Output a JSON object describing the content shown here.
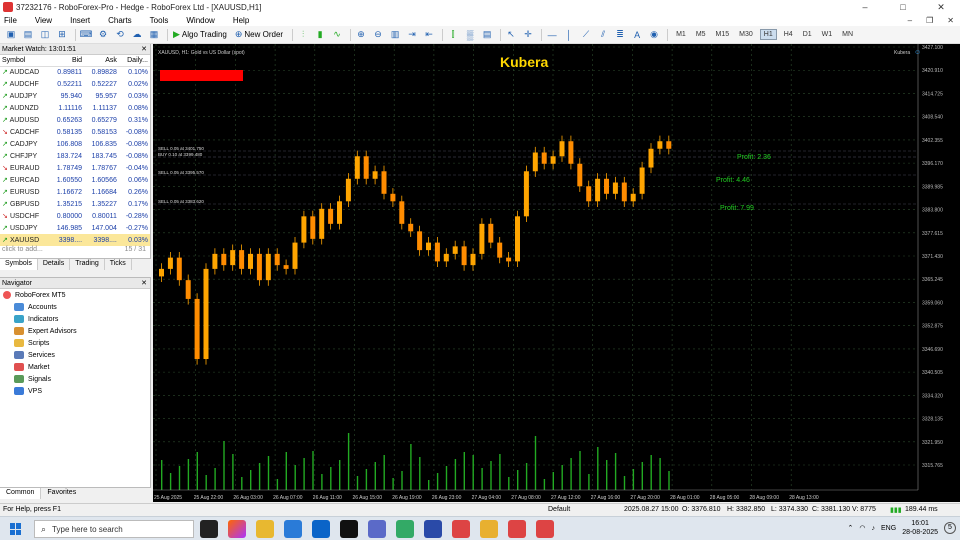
{
  "window": {
    "title": "37232176 - RoboForex-Pro - Hedge - RoboForex Ltd - [XAUUSD,H1]",
    "controls": [
      "–",
      "□",
      "✕"
    ]
  },
  "menu": [
    "File",
    "View",
    "Insert",
    "Charts",
    "Tools",
    "Window",
    "Help"
  ],
  "toolbar": {
    "algo_trading": "Algo Trading",
    "new_order": "New Order",
    "timeframes": [
      "M1",
      "M5",
      "M15",
      "M30",
      "H1",
      "H4",
      "D1",
      "W1",
      "MN"
    ],
    "active_timeframe": "H1"
  },
  "market_watch": {
    "title": "Market Watch: 13:01:51",
    "columns": [
      "Symbol",
      "Bid",
      "Ask",
      "Daily..."
    ],
    "rows": [
      {
        "symbol": "AUDCAD",
        "bid": "0.89811",
        "ask": "0.89828",
        "daily": "0.10%",
        "dir": "up"
      },
      {
        "symbol": "AUDCHF",
        "bid": "0.52211",
        "ask": "0.52227",
        "daily": "0.02%",
        "dir": "up"
      },
      {
        "symbol": "AUDJPY",
        "bid": "95.940",
        "ask": "95.957",
        "daily": "0.03%",
        "dir": "up"
      },
      {
        "symbol": "AUDNZD",
        "bid": "1.11116",
        "ask": "1.11137",
        "daily": "0.08%",
        "dir": "up"
      },
      {
        "symbol": "AUDUSD",
        "bid": "0.65263",
        "ask": "0.65279",
        "daily": "0.31%",
        "dir": "up"
      },
      {
        "symbol": "CADCHF",
        "bid": "0.58135",
        "ask": "0.58153",
        "daily": "-0.08%",
        "dir": "dn"
      },
      {
        "symbol": "CADJPY",
        "bid": "106.808",
        "ask": "106.835",
        "daily": "-0.08%",
        "dir": "up"
      },
      {
        "symbol": "CHFJPY",
        "bid": "183.724",
        "ask": "183.745",
        "daily": "-0.08%",
        "dir": "up"
      },
      {
        "symbol": "EURAUD",
        "bid": "1.78749",
        "ask": "1.78767",
        "daily": "-0.04%",
        "dir": "dn"
      },
      {
        "symbol": "EURCAD",
        "bid": "1.60550",
        "ask": "1.60566",
        "daily": "0.06%",
        "dir": "up"
      },
      {
        "symbol": "EURUSD",
        "bid": "1.16672",
        "ask": "1.16684",
        "daily": "0.26%",
        "dir": "up"
      },
      {
        "symbol": "GBPUSD",
        "bid": "1.35215",
        "ask": "1.35227",
        "daily": "0.17%",
        "dir": "up"
      },
      {
        "symbol": "USDCHF",
        "bid": "0.80000",
        "ask": "0.80011",
        "daily": "-0.28%",
        "dir": "dn"
      },
      {
        "symbol": "USDJPY",
        "bid": "146.985",
        "ask": "147.004",
        "daily": "-0.27%",
        "dir": "up"
      },
      {
        "symbol": "XAUUSD",
        "bid": "3398....",
        "ask": "3398....",
        "daily": "0.03%",
        "dir": "up"
      }
    ],
    "add_label": "click to add...",
    "count": "15 / 31",
    "tabs": [
      "Symbols",
      "Details",
      "Trading",
      "Ticks"
    ]
  },
  "navigator": {
    "title": "Navigator",
    "root": "RoboForex MT5",
    "items": [
      "Accounts",
      "Indicators",
      "Expert Advisors",
      "Scripts",
      "Services",
      "Market",
      "Signals",
      "VPS"
    ],
    "tabs": [
      "Common",
      "Favorites"
    ]
  },
  "chart": {
    "symbol_label": "XAUUSD, H1: Gold vs US Dollar (spot)",
    "ea_name": "Kubera",
    "ea_label": "Kubera",
    "order_lines": [
      "SELL 0.05 at 3401.750",
      "BUY 0.10 at 3399.480",
      "SELL 0.05 at 3395.570",
      "SELL 0.05 at 3383.620"
    ],
    "price_labels": [
      "3427.100",
      "3420.910",
      "3414.725",
      "3408.540",
      "3402.355",
      "3396.170",
      "3389.985",
      "3383.800",
      "3377.615",
      "3371.430",
      "3365.245",
      "3359.060",
      "3352.875",
      "3346.690",
      "3340.505",
      "3334.320",
      "3328.135",
      "3321.950",
      "3315.765"
    ],
    "time_labels": [
      "25 Aug 2025",
      "25 Aug 22:00",
      "26 Aug 03:00",
      "26 Aug 07:00",
      "26 Aug 11:00",
      "26 Aug 15:00",
      "26 Aug 19:00",
      "26 Aug 23:00",
      "27 Aug 04:00",
      "27 Aug 08:00",
      "27 Aug 12:00",
      "27 Aug 16:00",
      "27 Aug 20:00",
      "28 Aug 01:00",
      "28 Aug 05:00",
      "28 Aug 09:00",
      "28 Aug 13:00"
    ],
    "profit_labels": [
      "Profit: 2.36",
      "Profit: 4.46",
      "Profit: 7.99"
    ],
    "colors": {
      "background": "#000000",
      "candle_up": "#ffa500",
      "candle_down": "#ff8c00",
      "grid": "#2a4a2a",
      "volume": "#22aa22",
      "ea_text": "#ffd700",
      "red_box": "#ff0000"
    }
  },
  "chart_data": {
    "type": "candlestick",
    "x_range": [
      "25 Aug 2025",
      "28 Aug 13:00"
    ],
    "ylim": [
      3315.765,
      3427.1
    ],
    "candles_approx_close": [
      3368,
      3371,
      3365,
      3360,
      3344,
      3368,
      3372,
      3369,
      3373,
      3368,
      3372,
      3365,
      3372,
      3369,
      3368,
      3375,
      3382,
      3376,
      3384,
      3380,
      3386,
      3392,
      3398,
      3392,
      3394,
      3388,
      3386,
      3380,
      3378,
      3373,
      3375,
      3370,
      3372,
      3374,
      3369,
      3372,
      3380,
      3375,
      3371,
      3370,
      3382,
      3394,
      3399,
      3396,
      3398,
      3402,
      3396,
      3390,
      3386,
      3392,
      3388,
      3391,
      3386,
      3388,
      3395,
      3400,
      3402,
      3400
    ]
  },
  "status": {
    "help": "For Help, press F1",
    "profile": "Default",
    "datetime": "2025.08.27 15:00",
    "open": "O: 3376.810",
    "high": "H: 3382.850",
    "low": "L: 3374.330",
    "close": "C: 3381.130",
    "volume": "V: 8775",
    "conn": "189.44 ms"
  },
  "taskbar": {
    "search_placeholder": "Type here to search",
    "lang": "ENG",
    "time": "16:01",
    "date": "28-08-2025",
    "notif": "5"
  }
}
